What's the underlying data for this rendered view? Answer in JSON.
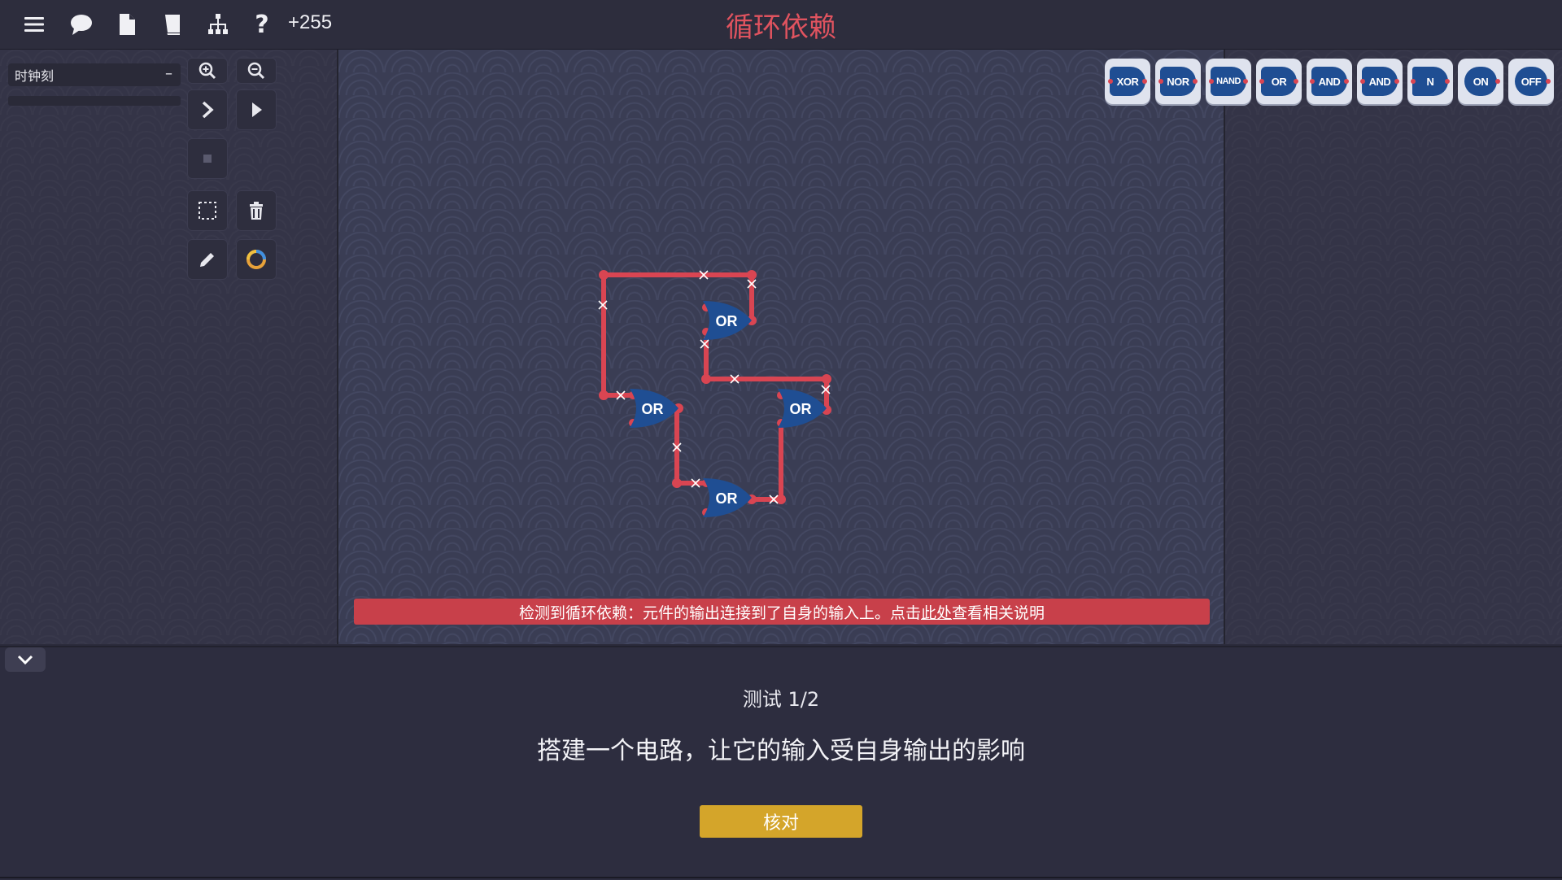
{
  "toolbar": {
    "icons": [
      "menu-icon",
      "chat-icon",
      "document-icon",
      "book-icon",
      "hierarchy-icon",
      "help-icon"
    ],
    "help_glyph": "?",
    "score": "+255"
  },
  "level_title": "循环依赖",
  "sidebar": {
    "clock_label": "时钟刻",
    "clock_dash": "–"
  },
  "palette": {
    "items": [
      {
        "label": "XOR",
        "icon": "xor-gate-icon"
      },
      {
        "label": "NOR",
        "icon": "nor-gate-icon"
      },
      {
        "label": "NAND",
        "icon": "nand-gate-icon"
      },
      {
        "label": "OR",
        "icon": "or-gate-icon"
      },
      {
        "label": "AND",
        "icon": "and-gate-icon"
      },
      {
        "label": "AND",
        "icon": "and-gate-icon"
      },
      {
        "label": "N",
        "icon": "not-gate-icon"
      },
      {
        "label": "ON",
        "icon": "on-switch-icon"
      },
      {
        "label": "OFF",
        "icon": "off-switch-icon"
      }
    ]
  },
  "circuit": {
    "gates": [
      {
        "label": "OR"
      },
      {
        "label": "OR"
      },
      {
        "label": "OR"
      },
      {
        "label": "OR"
      }
    ],
    "wire_color": "#d94552",
    "gate_color": "#1f4e93"
  },
  "error": {
    "text_before": "检测到循环依赖：元件的输出连接到了自身的输入上。点击",
    "link": "此处",
    "text_after": "查看相关说明"
  },
  "test": {
    "label": "测试 1/2",
    "task": "搭建一个电路，让它的输入受自身输出的影响",
    "check_button": "核对"
  },
  "colors": {
    "title_red": "#e0535f",
    "error_red": "#c8404a",
    "check_gold": "#d4a52a"
  }
}
